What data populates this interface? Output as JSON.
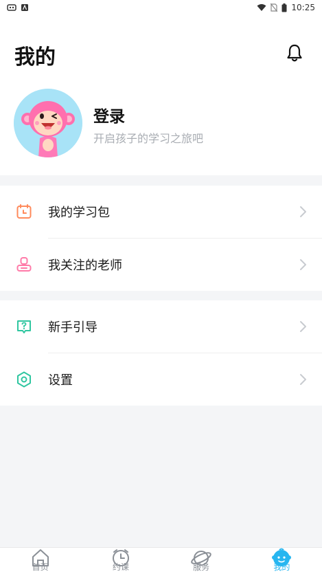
{
  "status_bar": {
    "time": "10:25"
  },
  "header": {
    "title": "我的"
  },
  "profile": {
    "login_label": "登录",
    "subtitle": "开启孩子的学习之旅吧"
  },
  "menu_group_1": [
    {
      "label": "我的学习包",
      "icon": "calendar-icon",
      "color": "#ff8a5b"
    },
    {
      "label": "我关注的老师",
      "icon": "teacher-icon",
      "color": "#ff7aa8"
    }
  ],
  "menu_group_2": [
    {
      "label": "新手引导",
      "icon": "question-icon",
      "color": "#2fc6a0"
    },
    {
      "label": "设置",
      "icon": "settings-icon",
      "color": "#2fc6a0"
    }
  ],
  "tabbar": [
    {
      "label": "首页",
      "icon": "home-icon",
      "active": false
    },
    {
      "label": "约课",
      "icon": "clock-icon",
      "active": false
    },
    {
      "label": "服务",
      "icon": "planet-icon",
      "active": false
    },
    {
      "label": "我的",
      "icon": "baby-face-icon",
      "active": true
    }
  ],
  "colors": {
    "accent": "#27b6f0",
    "avatar_bg": "#a8e3f7"
  }
}
